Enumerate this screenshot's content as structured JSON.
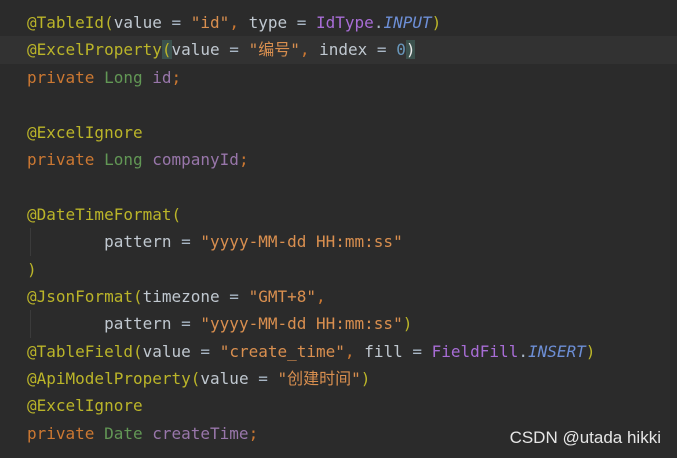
{
  "editor": {
    "lines": [
      {
        "tokens": [
          {
            "text": "@TableId",
            "kind": "ann"
          },
          {
            "text": "(",
            "kind": "ann"
          },
          {
            "text": "value",
            "kind": "pname"
          },
          {
            "text": " = ",
            "kind": "plain"
          },
          {
            "text": "\"id\"",
            "kind": "str"
          },
          {
            "text": ", ",
            "kind": "kw"
          },
          {
            "text": "type",
            "kind": "pname"
          },
          {
            "text": " = ",
            "kind": "plain"
          },
          {
            "text": "IdType",
            "kind": "enumcls"
          },
          {
            "text": ".",
            "kind": "plain"
          },
          {
            "text": "INPUT",
            "kind": "enumval"
          },
          {
            "text": ")",
            "kind": "ann"
          }
        ]
      },
      {
        "current": true,
        "tokens": [
          {
            "text": "@ExcelProperty",
            "kind": "ann"
          },
          {
            "text": "(",
            "kind": "paren-match"
          },
          {
            "text": "value",
            "kind": "pname"
          },
          {
            "text": " = ",
            "kind": "plain"
          },
          {
            "text": "\"编号\"",
            "kind": "str"
          },
          {
            "text": ", ",
            "kind": "kw"
          },
          {
            "text": "index",
            "kind": "pname"
          },
          {
            "text": " = ",
            "kind": "plain"
          },
          {
            "text": "0",
            "kind": "num"
          },
          {
            "text": ")",
            "kind": "paren-match-right"
          }
        ]
      },
      {
        "tokens": [
          {
            "text": "private ",
            "kind": "kw"
          },
          {
            "text": "Long ",
            "kind": "type"
          },
          {
            "text": "id",
            "kind": "field"
          },
          {
            "text": ";",
            "kind": "kw"
          }
        ]
      },
      {
        "tokens": []
      },
      {
        "tokens": [
          {
            "text": "@ExcelIgnore",
            "kind": "ann"
          }
        ]
      },
      {
        "tokens": [
          {
            "text": "private ",
            "kind": "kw"
          },
          {
            "text": "Long ",
            "kind": "type"
          },
          {
            "text": "companyId",
            "kind": "field"
          },
          {
            "text": ";",
            "kind": "kw"
          }
        ]
      },
      {
        "tokens": []
      },
      {
        "tokens": [
          {
            "text": "@DateTimeFormat",
            "kind": "ann"
          },
          {
            "text": "(",
            "kind": "ann"
          }
        ]
      },
      {
        "guide": true,
        "tokens": [
          {
            "text": "        ",
            "kind": "plain"
          },
          {
            "text": "pattern",
            "kind": "pname"
          },
          {
            "text": " = ",
            "kind": "plain"
          },
          {
            "text": "\"yyyy-MM-dd HH:mm:ss\"",
            "kind": "str"
          }
        ]
      },
      {
        "tokens": [
          {
            "text": ")",
            "kind": "ann"
          }
        ]
      },
      {
        "tokens": [
          {
            "text": "@JsonFormat",
            "kind": "ann"
          },
          {
            "text": "(",
            "kind": "ann"
          },
          {
            "text": "timezone",
            "kind": "pname"
          },
          {
            "text": " = ",
            "kind": "plain"
          },
          {
            "text": "\"GMT+8\"",
            "kind": "str"
          },
          {
            "text": ",",
            "kind": "kw"
          }
        ]
      },
      {
        "guide": true,
        "tokens": [
          {
            "text": "        ",
            "kind": "plain"
          },
          {
            "text": "pattern",
            "kind": "pname"
          },
          {
            "text": " = ",
            "kind": "plain"
          },
          {
            "text": "\"yyyy-MM-dd HH:mm:ss\"",
            "kind": "str"
          },
          {
            "text": ")",
            "kind": "ann"
          }
        ]
      },
      {
        "tokens": [
          {
            "text": "@TableField",
            "kind": "ann"
          },
          {
            "text": "(",
            "kind": "ann"
          },
          {
            "text": "value",
            "kind": "pname"
          },
          {
            "text": " = ",
            "kind": "plain"
          },
          {
            "text": "\"create_time\"",
            "kind": "str"
          },
          {
            "text": ", ",
            "kind": "kw"
          },
          {
            "text": "fill",
            "kind": "pname"
          },
          {
            "text": " = ",
            "kind": "plain"
          },
          {
            "text": "FieldFill",
            "kind": "enumcls"
          },
          {
            "text": ".",
            "kind": "plain"
          },
          {
            "text": "INSERT",
            "kind": "enumval"
          },
          {
            "text": ")",
            "kind": "ann"
          }
        ]
      },
      {
        "tokens": [
          {
            "text": "@ApiModelProperty",
            "kind": "ann"
          },
          {
            "text": "(",
            "kind": "ann"
          },
          {
            "text": "value",
            "kind": "pname"
          },
          {
            "text": " = ",
            "kind": "plain"
          },
          {
            "text": "\"创建时间\"",
            "kind": "str"
          },
          {
            "text": ")",
            "kind": "ann"
          }
        ]
      },
      {
        "tokens": [
          {
            "text": "@ExcelIgnore",
            "kind": "ann"
          }
        ]
      },
      {
        "tokens": [
          {
            "text": "private ",
            "kind": "kw"
          },
          {
            "text": "Date ",
            "kind": "type"
          },
          {
            "text": "createTime",
            "kind": "field"
          },
          {
            "text": ";",
            "kind": "kw"
          }
        ]
      }
    ]
  },
  "watermark": "CSDN @utada hikki",
  "colors": {
    "background": "#2b2b2b",
    "current_line": "#323232",
    "annotation": "#bbb529",
    "keyword": "#cc7832",
    "type": "#629755",
    "field": "#9876aa",
    "string": "#d98f4f",
    "number": "#6897bb",
    "enum_constant": "#6d8fd6"
  }
}
